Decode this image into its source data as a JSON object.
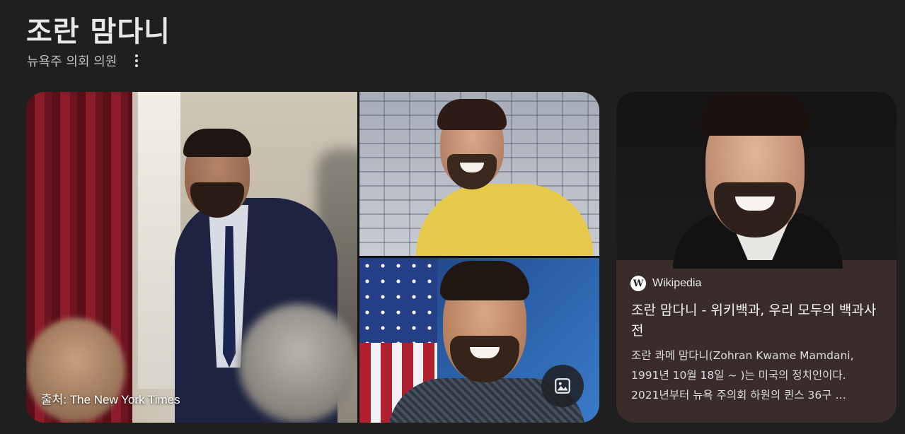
{
  "header": {
    "title": "조란 맘다니",
    "subtitle": "뉴욕주 의회 의원"
  },
  "images": {
    "main_caption": "출처: The New York Times"
  },
  "wiki_card": {
    "source_logo": "W",
    "source_name": "Wikipedia",
    "title": "조란 맘다니 - 위키백과, 우리 모두의 백과사전",
    "snippet_lines": [
      "조란 콰메 맘다니(Zohran Kwame Mamdani,",
      "1991년 10월 18일 ~ )는 미국의 정치인이다.",
      "2021년부터 뉴욕 주의회 하원의 퀸스 36구 …"
    ]
  },
  "icons": {
    "more": "more-vert-icon",
    "image_search": "image-search-icon"
  },
  "colors": {
    "background": "#1f1f1f",
    "card": "#3a2c2a",
    "title_text": "#e8e8e8",
    "subtitle_text": "#bdc1c6"
  }
}
